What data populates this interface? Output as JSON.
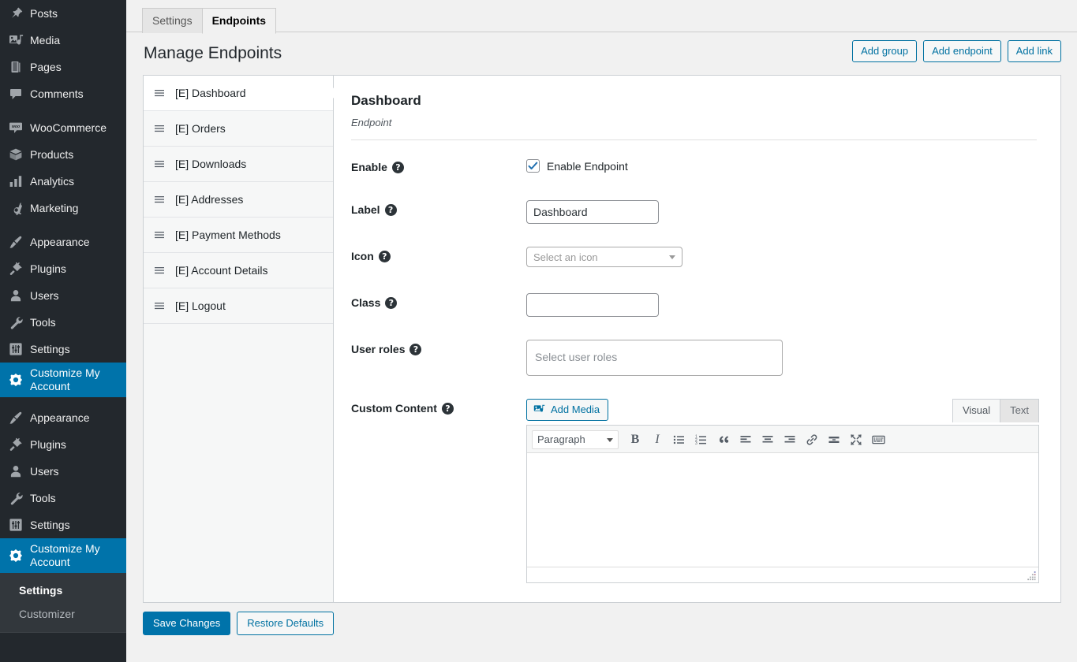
{
  "sidebar": {
    "groups": [
      {
        "items": [
          {
            "label": "Posts",
            "icon": "pin-icon",
            "name": "sidebar-item-posts"
          },
          {
            "label": "Media",
            "icon": "media-icon",
            "name": "sidebar-item-media"
          },
          {
            "label": "Pages",
            "icon": "pages-icon",
            "name": "sidebar-item-pages"
          },
          {
            "label": "Comments",
            "icon": "comments-icon",
            "name": "sidebar-item-comments"
          }
        ]
      },
      {
        "items": [
          {
            "label": "WooCommerce",
            "icon": "woocommerce-icon",
            "name": "sidebar-item-woocommerce"
          },
          {
            "label": "Products",
            "icon": "products-box-icon",
            "name": "sidebar-item-products"
          },
          {
            "label": "Analytics",
            "icon": "analytics-bars-icon",
            "name": "sidebar-item-analytics"
          },
          {
            "label": "Marketing",
            "icon": "marketing-megaphone-icon",
            "name": "sidebar-item-marketing"
          }
        ]
      },
      {
        "items": [
          {
            "label": "Appearance",
            "icon": "appearance-brush-icon",
            "name": "sidebar-item-appearance"
          },
          {
            "label": "Plugins",
            "icon": "plugins-plug-icon",
            "name": "sidebar-item-plugins"
          },
          {
            "label": "Users",
            "icon": "users-person-icon",
            "name": "sidebar-item-users"
          },
          {
            "label": "Tools",
            "icon": "tools-wrench-icon",
            "name": "sidebar-item-tools"
          },
          {
            "label": "Settings",
            "icon": "settings-sliders-icon",
            "name": "sidebar-item-settings"
          },
          {
            "label": "Customize My Account",
            "icon": "gear-icon",
            "name": "sidebar-item-customize-my-account",
            "current": true
          }
        ]
      },
      {
        "items": [
          {
            "label": "Appearance",
            "icon": "appearance-brush-icon",
            "name": "sidebar-item-appearance-2"
          },
          {
            "label": "Plugins",
            "icon": "plugins-plug-icon",
            "name": "sidebar-item-plugins-2"
          },
          {
            "label": "Users",
            "icon": "users-person-icon",
            "name": "sidebar-item-users-2"
          },
          {
            "label": "Tools",
            "icon": "tools-wrench-icon",
            "name": "sidebar-item-tools-2"
          },
          {
            "label": "Settings",
            "icon": "settings-sliders-icon",
            "name": "sidebar-item-settings-2"
          },
          {
            "label": "Customize My Account",
            "icon": "gear-icon",
            "name": "sidebar-item-customize-my-account-2",
            "current": true
          }
        ]
      }
    ],
    "submenu": [
      {
        "label": "Settings",
        "current": true
      },
      {
        "label": "Customizer",
        "current": false
      }
    ]
  },
  "tabs": [
    {
      "label": "Settings",
      "active": false
    },
    {
      "label": "Endpoints",
      "active": true
    }
  ],
  "header": {
    "title": "Manage Endpoints",
    "actions": [
      {
        "label": "Add group",
        "name": "add-group-button"
      },
      {
        "label": "Add endpoint",
        "name": "add-endpoint-button"
      },
      {
        "label": "Add link",
        "name": "add-link-button"
      }
    ]
  },
  "endpoint_list": [
    {
      "label": "[E] Dashboard",
      "active": true
    },
    {
      "label": "[E] Orders",
      "active": false
    },
    {
      "label": "[E] Downloads",
      "active": false
    },
    {
      "label": "[E] Addresses",
      "active": false
    },
    {
      "label": "[E] Payment Methods",
      "active": false
    },
    {
      "label": "[E] Account Details",
      "active": false
    },
    {
      "label": "[E] Logout",
      "active": false
    }
  ],
  "panel": {
    "title": "Dashboard",
    "subtitle": "Endpoint",
    "help_glyph": "?",
    "fields": {
      "enable": {
        "label": "Enable",
        "checkbox_label": "Enable Endpoint",
        "checked": true
      },
      "label": {
        "label": "Label",
        "value": "Dashboard",
        "placeholder": ""
      },
      "icon": {
        "label": "Icon",
        "value": "Select an icon"
      },
      "class": {
        "label": "Class",
        "value": "",
        "placeholder": ""
      },
      "user_roles": {
        "label": "User roles",
        "placeholder": "Select user roles"
      },
      "custom_content": {
        "label": "Custom Content"
      }
    }
  },
  "editor": {
    "add_media_label": "Add Media",
    "tabs": [
      {
        "label": "Visual",
        "active": true
      },
      {
        "label": "Text",
        "active": false
      }
    ],
    "format_select": "Paragraph",
    "toolbar": [
      {
        "name": "bold-icon",
        "glyph": "B"
      },
      {
        "name": "italic-icon",
        "glyph": "I"
      },
      {
        "name": "bulleted-list-icon",
        "glyph": ""
      },
      {
        "name": "numbered-list-icon",
        "glyph": ""
      },
      {
        "name": "blockquote-icon",
        "glyph": ""
      },
      {
        "name": "align-left-icon",
        "glyph": ""
      },
      {
        "name": "align-center-icon",
        "glyph": ""
      },
      {
        "name": "align-right-icon",
        "glyph": ""
      },
      {
        "name": "insert-link-icon",
        "glyph": ""
      },
      {
        "name": "read-more-icon",
        "glyph": ""
      },
      {
        "name": "fullscreen-icon",
        "glyph": ""
      },
      {
        "name": "keyboard-shortcuts-icon",
        "glyph": ""
      }
    ],
    "content": ""
  },
  "footer": {
    "save_label": "Save Changes",
    "restore_label": "Restore Defaults"
  },
  "colors": {
    "admin_bg": "#23282d",
    "accent": "#0073aa",
    "submenu_bg": "#32373c",
    "content_bg": "#f1f1f1",
    "panel_border": "#ccd0d4",
    "link": "#0071a1"
  }
}
